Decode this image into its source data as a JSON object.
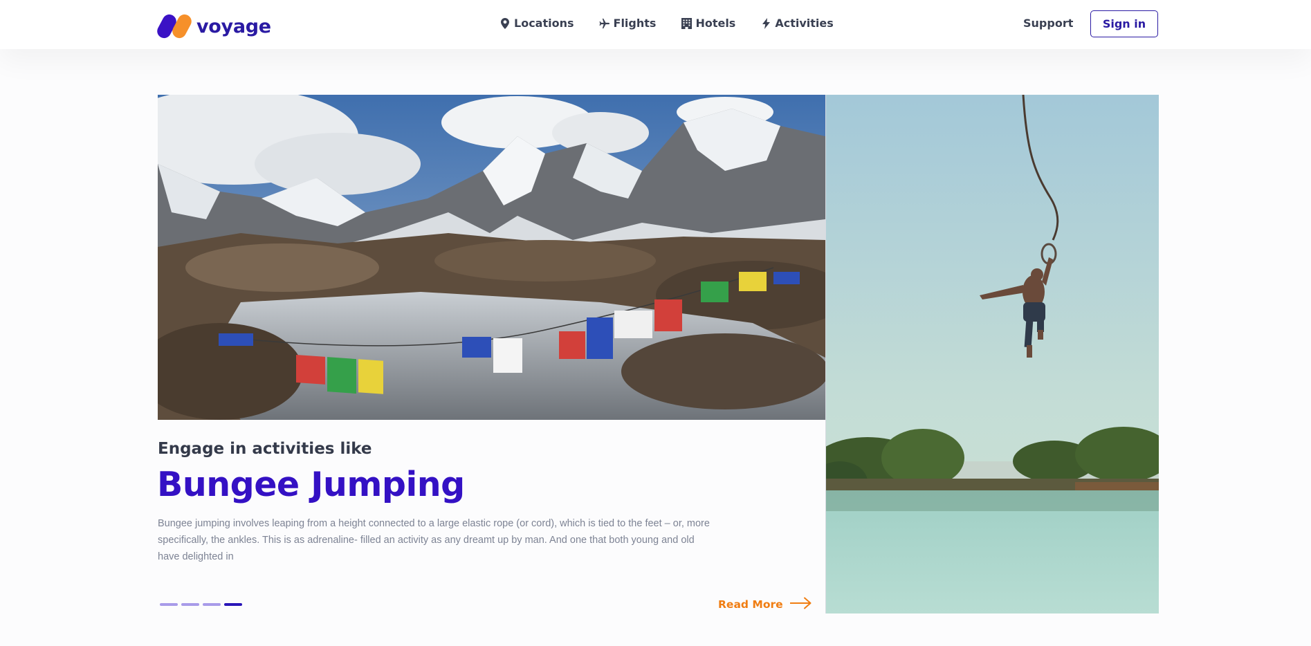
{
  "brand": {
    "name": "voyage",
    "colors": {
      "primary": "#3411c4",
      "accent": "#f07d12"
    }
  },
  "nav": {
    "items": [
      {
        "label": "Locations",
        "icon": "map-pin-icon"
      },
      {
        "label": "Flights",
        "icon": "plane-icon"
      },
      {
        "label": "Hotels",
        "icon": "building-icon"
      },
      {
        "label": "Activities",
        "icon": "lightning-icon"
      }
    ],
    "support_label": "Support",
    "signin_label": "Sign in"
  },
  "hero": {
    "kicker": "Engage in activities like",
    "title": "Bungee Jumping",
    "description": "Bungee jumping involves leaping from a height connected to a large elastic rope (or cord), which is tied to the feet – or, more specifically, the ankles. This is as adrenaline- filled an activity as any dreamt up by man. And one that both young and old have delighted in",
    "read_more_label": "Read More",
    "slides": {
      "count": 4,
      "active": 4
    },
    "images": [
      {
        "subject": "snowy mountains with prayer flags over a frozen stream"
      },
      {
        "subject": "man bungee jumping above a lake"
      }
    ]
  }
}
